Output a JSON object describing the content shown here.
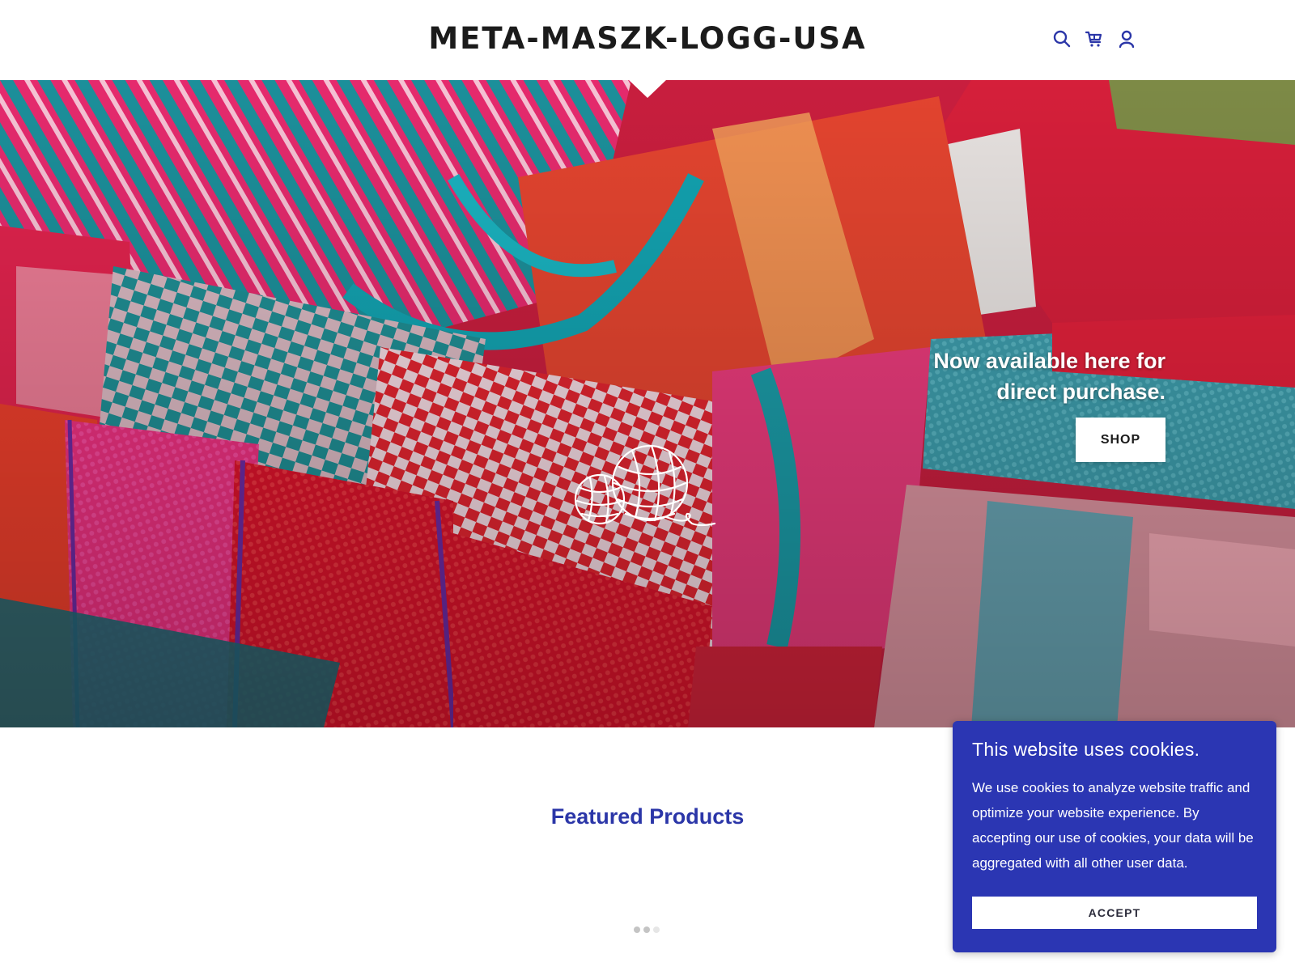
{
  "header": {
    "site_title": "META-MASZK-LOGG-USA",
    "icons": [
      "search-icon",
      "cart-icon",
      "account-icon"
    ],
    "icon_color": "#2b36a8"
  },
  "hero": {
    "tagline": "Now available here for direct purchase.",
    "shop_label": "SHOP",
    "logo": "yarn-balls-icon"
  },
  "featured": {
    "title": "Featured Products",
    "title_color": "#2b36a8",
    "carousel_dots": 3,
    "active_dot": 1
  },
  "cookie_banner": {
    "title": "This website uses cookies.",
    "text": "We use cookies to analyze website traffic and optimize your website experience. By accepting our use of cookies, your data will be aggregated with all other user data.",
    "accept_label": "ACCEPT",
    "background": "#2b36b3"
  }
}
